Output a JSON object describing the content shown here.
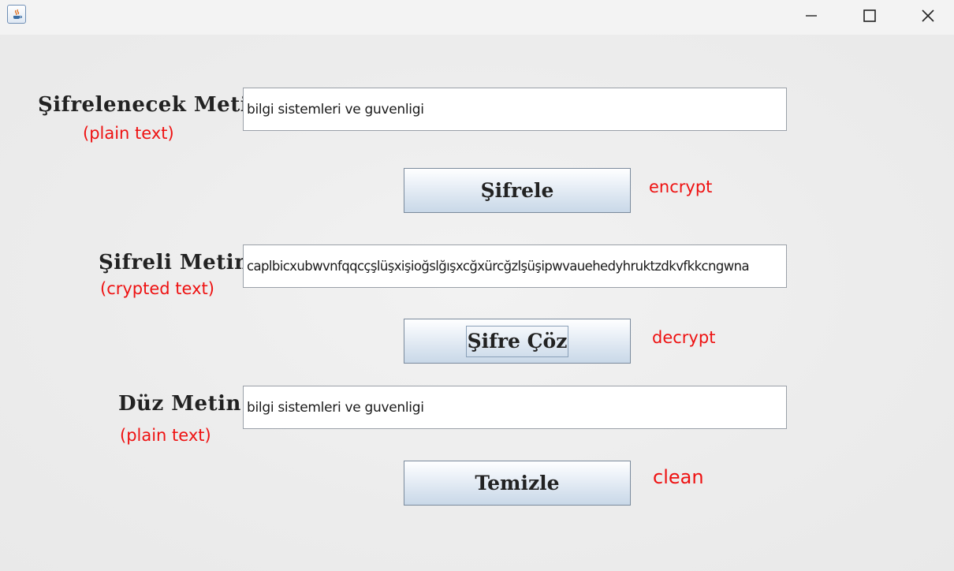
{
  "window": {
    "icon": "java-app-icon",
    "controls": [
      "minimize-icon",
      "maximize-icon",
      "close-icon"
    ]
  },
  "rows": {
    "plain": {
      "label": "Şifrelenecek Metin:",
      "hint": "(plain text)",
      "value": "bilgi sistemleri ve guvenligi"
    },
    "encrypt": {
      "button": "Şifrele",
      "hint": "encrypt"
    },
    "cipher": {
      "label": "Şifreli Metin:",
      "hint": "(crypted text)",
      "value": "caplbicxubwvnfqqcçşlüşxişioğslğışxcğxürcğzlşüşipwvauehedyhruktzdkvfkkcngwna"
    },
    "decrypt": {
      "button": "Şifre Çöz",
      "hint": "decrypt"
    },
    "result": {
      "label": "Düz Metin:",
      "hint": "(plain text)",
      "value": "bilgi sistemleri ve guvenligi"
    },
    "clean": {
      "button": "Temizle",
      "hint": "clean"
    }
  },
  "colors": {
    "hint": "#ee1111",
    "label": "#222222",
    "button_top": "#ffffff",
    "button_bottom": "#c9d8e8"
  }
}
